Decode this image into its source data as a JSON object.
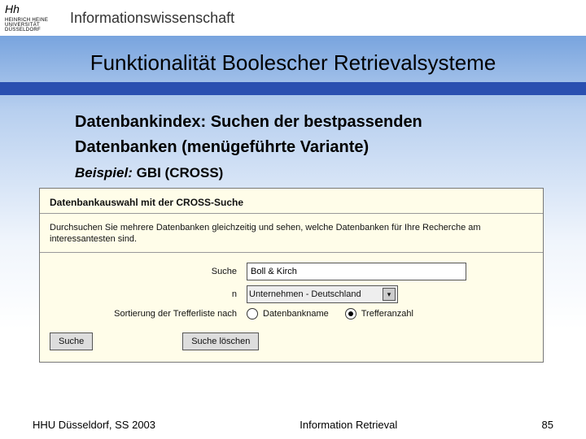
{
  "header": {
    "uni_script": "Hh",
    "uni_small": "HEINRICH HEINE\nUNIVERSITÄT\nDÜSSELDORF",
    "dept": "Informationswissenschaft"
  },
  "title": "Funktionalität Boolescher Retrievalsysteme",
  "subheading_l1": "Datenbankindex: Suchen der bestpassenden",
  "subheading_l2": "Datenbanken (menügeführte Variante)",
  "example_label": "Beispiel:",
  "example_value": "GBI (CROSS)",
  "shot": {
    "section_title": "Datenbankauswahl mit der CROSS-Suche",
    "paragraph": "Durchsuchen Sie mehrere Datenbanken gleichzeitig und sehen, welche Datenbanken für Ihre Recherche am interessantesten sind.",
    "label_search": "Suche",
    "input_search_value": "Boll & Kirch",
    "label_in": "n",
    "select_value": "Unternehmen - Deutschland",
    "label_sort": "Sortierung der Trefferliste nach",
    "radio_dbname": "Datenbankname",
    "radio_hits": "Trefferanzahl",
    "btn_search": "Suche",
    "btn_clear": "Suche löschen"
  },
  "footer": {
    "left": "HHU Düsseldorf, SS 2003",
    "center": "Information Retrieval",
    "right": "85"
  }
}
